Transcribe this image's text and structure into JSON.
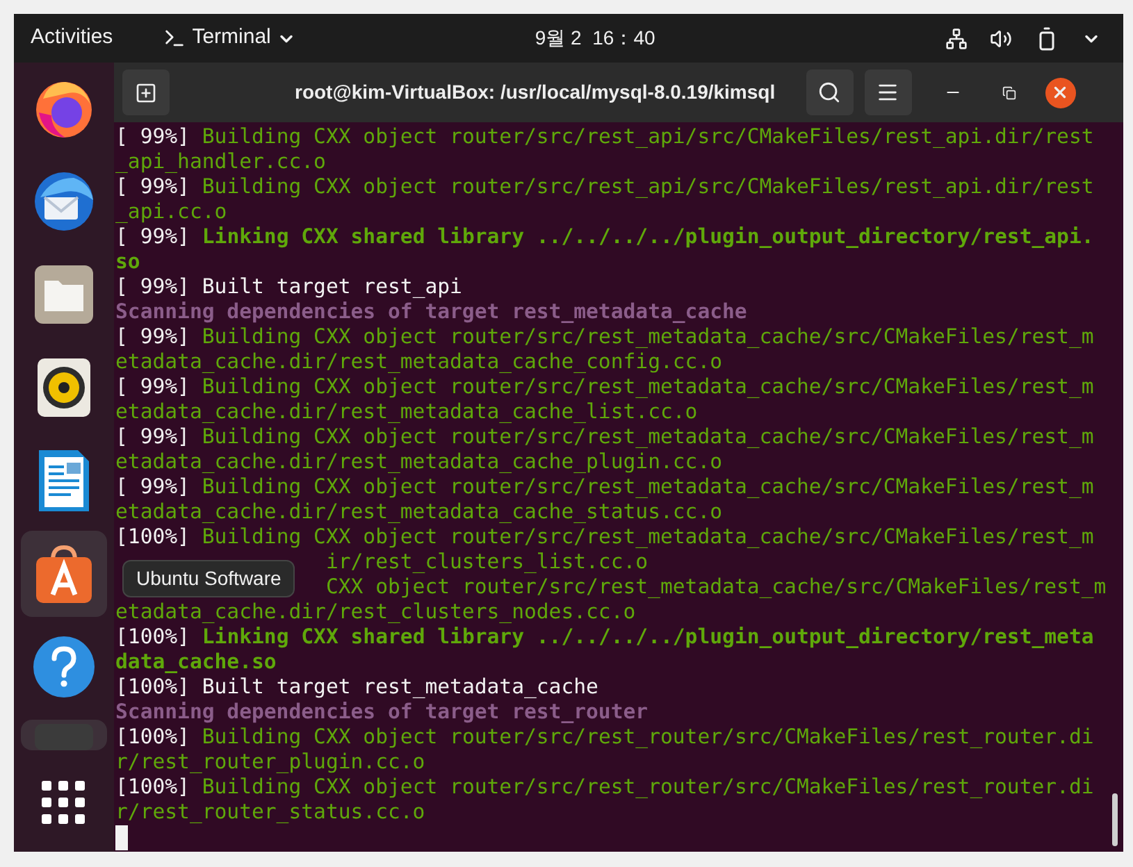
{
  "top_bar": {
    "activities": "Activities",
    "app_menu": "Terminal",
    "clock": "9월 2  16：40"
  },
  "dock": {
    "items": [
      {
        "kind": "firefox",
        "selected": false
      },
      {
        "kind": "mail",
        "selected": false
      },
      {
        "kind": "files",
        "selected": false
      },
      {
        "kind": "speaker",
        "selected": false
      },
      {
        "kind": "writer",
        "selected": false
      },
      {
        "kind": "software",
        "selected": true
      },
      {
        "kind": "help",
        "selected": false
      },
      {
        "kind": "terminal",
        "selected": true
      }
    ],
    "tooltip": "Ubuntu Software"
  },
  "window": {
    "title": "root@kim-VirtualBox: /usr/local/mysql-8.0.19/kimsql"
  },
  "terminal": {
    "lines": [
      {
        "kind": "build",
        "prefix": "[ 99%]",
        "text": "Building CXX object router/src/rest_api/src/CMakeFiles/rest_api.dir/rest"
      },
      {
        "kind": "build",
        "text": "_api_handler.cc.o"
      },
      {
        "kind": "build",
        "prefix": "[ 99%]",
        "text": "Building CXX object router/src/rest_api/src/CMakeFiles/rest_api.dir/rest"
      },
      {
        "kind": "build",
        "text": "_api.cc.o"
      },
      {
        "kind": "link",
        "prefix": "[ 99%]",
        "text": "Linking CXX shared library ../../../../plugin_output_directory/rest_api."
      },
      {
        "kind": "link",
        "text": "so"
      },
      {
        "kind": "built",
        "prefix": "[ 99%]",
        "text": "Built target rest_api"
      },
      {
        "kind": "scan",
        "text": "Scanning dependencies of target rest_metadata_cache"
      },
      {
        "kind": "build",
        "prefix": "[ 99%]",
        "text": "Building CXX object router/src/rest_metadata_cache/src/CMakeFiles/rest_m"
      },
      {
        "kind": "build",
        "text": "etadata_cache.dir/rest_metadata_cache_config.cc.o"
      },
      {
        "kind": "build",
        "prefix": "[ 99%]",
        "text": "Building CXX object router/src/rest_metadata_cache/src/CMakeFiles/rest_m"
      },
      {
        "kind": "build",
        "text": "etadata_cache.dir/rest_metadata_cache_list.cc.o"
      },
      {
        "kind": "build",
        "prefix": "[ 99%]",
        "text": "Building CXX object router/src/rest_metadata_cache/src/CMakeFiles/rest_m"
      },
      {
        "kind": "build",
        "text": "etadata_cache.dir/rest_metadata_cache_plugin.cc.o"
      },
      {
        "kind": "build",
        "prefix": "[ 99%]",
        "text": "Building CXX object router/src/rest_metadata_cache/src/CMakeFiles/rest_m"
      },
      {
        "kind": "build",
        "text": "etadata_cache.dir/rest_metadata_cache_status.cc.o"
      },
      {
        "kind": "build",
        "prefix": "[100%]",
        "text": "Building CXX object router/src/rest_metadata_cache/src/CMakeFiles/rest_m"
      },
      {
        "kind": "build",
        "text": "ir/rest_clusters_list.cc.o",
        "under_tooltip": true
      },
      {
        "kind": "build",
        "text": "CXX object router/src/rest_metadata_cache/src/CMakeFiles/rest_m",
        "under_tooltip": true
      },
      {
        "kind": "build",
        "text": "etadata_cache.dir/rest_clusters_nodes.cc.o"
      },
      {
        "kind": "link",
        "prefix": "[100%]",
        "text": "Linking CXX shared library ../../../../plugin_output_directory/rest_meta"
      },
      {
        "kind": "link",
        "text": "data_cache.so"
      },
      {
        "kind": "built",
        "prefix": "[100%]",
        "text": "Built target rest_metadata_cache"
      },
      {
        "kind": "scan",
        "text": "Scanning dependencies of target rest_router"
      },
      {
        "kind": "build",
        "prefix": "[100%]",
        "text": "Building CXX object router/src/rest_router/src/CMakeFiles/rest_router.di"
      },
      {
        "kind": "build",
        "text": "r/rest_router_plugin.cc.o"
      },
      {
        "kind": "build",
        "prefix": "[100%]",
        "text": "Building CXX object router/src/rest_router/src/CMakeFiles/rest_router.di"
      },
      {
        "kind": "build",
        "text": "r/rest_router_status.cc.o"
      }
    ]
  }
}
